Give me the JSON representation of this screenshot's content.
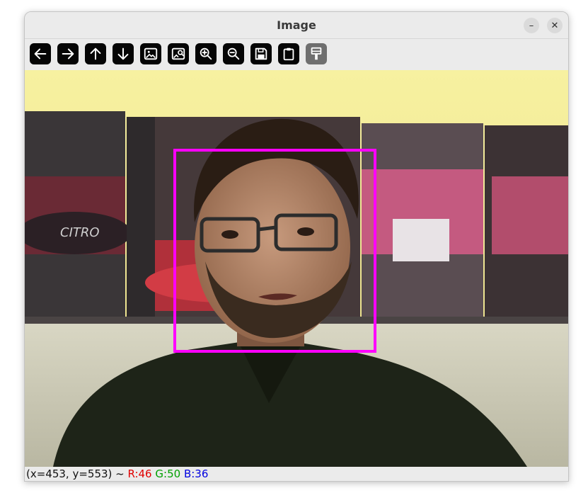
{
  "window": {
    "title": "Image",
    "minimize_label": "–",
    "close_label": "✕"
  },
  "toolbar": {
    "buttons": [
      {
        "name": "pan-left-button",
        "icon": "arrow-left-icon",
        "enabled": true
      },
      {
        "name": "pan-right-button",
        "icon": "arrow-right-icon",
        "enabled": true
      },
      {
        "name": "pan-up-button",
        "icon": "arrow-up-icon",
        "enabled": true
      },
      {
        "name": "pan-down-button",
        "icon": "arrow-down-icon",
        "enabled": true
      },
      {
        "name": "zoom-fit-button",
        "icon": "image-icon",
        "enabled": true
      },
      {
        "name": "zoom-original-button",
        "icon": "image-search-icon",
        "enabled": true
      },
      {
        "name": "zoom-in-button",
        "icon": "zoom-in-icon",
        "enabled": true
      },
      {
        "name": "zoom-out-button",
        "icon": "zoom-out-icon",
        "enabled": true
      },
      {
        "name": "save-button",
        "icon": "floppy-disk-icon",
        "enabled": true
      },
      {
        "name": "copy-clipboard-button",
        "icon": "clipboard-icon",
        "enabled": true
      },
      {
        "name": "properties-button",
        "icon": "paint-brush-icon",
        "enabled": false
      }
    ]
  },
  "image": {
    "description_icon": "photo",
    "detection_box_color": "#ff00ff"
  },
  "status": {
    "coords": "(x=453, y=553) ~ ",
    "r": "R:46",
    "g": "G:50",
    "b": "B:36"
  },
  "colors": {
    "toolbar_button_bg": "#050505",
    "window_bg": "#ebebeb",
    "box": "#ff00ff"
  }
}
